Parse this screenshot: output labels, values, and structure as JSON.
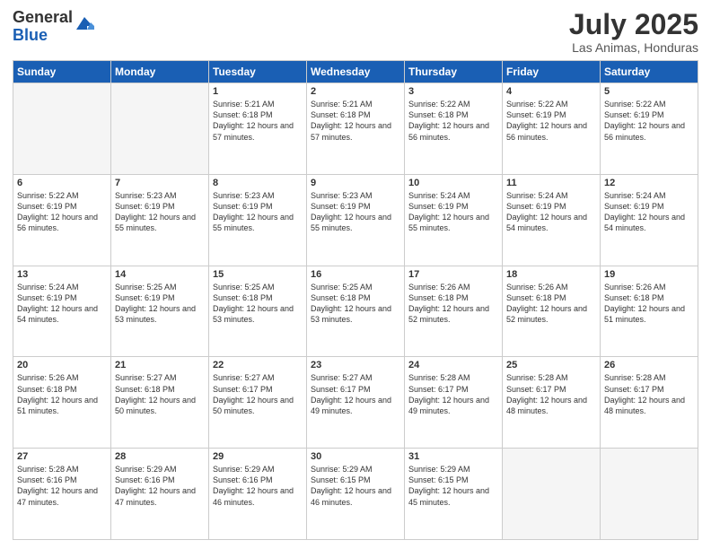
{
  "logo": {
    "general": "General",
    "blue": "Blue"
  },
  "header": {
    "month_year": "July 2025",
    "location": "Las Animas, Honduras"
  },
  "weekdays": [
    "Sunday",
    "Monday",
    "Tuesday",
    "Wednesday",
    "Thursday",
    "Friday",
    "Saturday"
  ],
  "weeks": [
    [
      {
        "day": "",
        "empty": true
      },
      {
        "day": "",
        "empty": true
      },
      {
        "day": "1",
        "sunrise": "5:21 AM",
        "sunset": "6:18 PM",
        "daylight": "12 hours and 57 minutes."
      },
      {
        "day": "2",
        "sunrise": "5:21 AM",
        "sunset": "6:18 PM",
        "daylight": "12 hours and 57 minutes."
      },
      {
        "day": "3",
        "sunrise": "5:22 AM",
        "sunset": "6:18 PM",
        "daylight": "12 hours and 56 minutes."
      },
      {
        "day": "4",
        "sunrise": "5:22 AM",
        "sunset": "6:19 PM",
        "daylight": "12 hours and 56 minutes."
      },
      {
        "day": "5",
        "sunrise": "5:22 AM",
        "sunset": "6:19 PM",
        "daylight": "12 hours and 56 minutes."
      }
    ],
    [
      {
        "day": "6",
        "sunrise": "5:22 AM",
        "sunset": "6:19 PM",
        "daylight": "12 hours and 56 minutes."
      },
      {
        "day": "7",
        "sunrise": "5:23 AM",
        "sunset": "6:19 PM",
        "daylight": "12 hours and 55 minutes."
      },
      {
        "day": "8",
        "sunrise": "5:23 AM",
        "sunset": "6:19 PM",
        "daylight": "12 hours and 55 minutes."
      },
      {
        "day": "9",
        "sunrise": "5:23 AM",
        "sunset": "6:19 PM",
        "daylight": "12 hours and 55 minutes."
      },
      {
        "day": "10",
        "sunrise": "5:24 AM",
        "sunset": "6:19 PM",
        "daylight": "12 hours and 55 minutes."
      },
      {
        "day": "11",
        "sunrise": "5:24 AM",
        "sunset": "6:19 PM",
        "daylight": "12 hours and 54 minutes."
      },
      {
        "day": "12",
        "sunrise": "5:24 AM",
        "sunset": "6:19 PM",
        "daylight": "12 hours and 54 minutes."
      }
    ],
    [
      {
        "day": "13",
        "sunrise": "5:24 AM",
        "sunset": "6:19 PM",
        "daylight": "12 hours and 54 minutes."
      },
      {
        "day": "14",
        "sunrise": "5:25 AM",
        "sunset": "6:19 PM",
        "daylight": "12 hours and 53 minutes."
      },
      {
        "day": "15",
        "sunrise": "5:25 AM",
        "sunset": "6:18 PM",
        "daylight": "12 hours and 53 minutes."
      },
      {
        "day": "16",
        "sunrise": "5:25 AM",
        "sunset": "6:18 PM",
        "daylight": "12 hours and 53 minutes."
      },
      {
        "day": "17",
        "sunrise": "5:26 AM",
        "sunset": "6:18 PM",
        "daylight": "12 hours and 52 minutes."
      },
      {
        "day": "18",
        "sunrise": "5:26 AM",
        "sunset": "6:18 PM",
        "daylight": "12 hours and 52 minutes."
      },
      {
        "day": "19",
        "sunrise": "5:26 AM",
        "sunset": "6:18 PM",
        "daylight": "12 hours and 51 minutes."
      }
    ],
    [
      {
        "day": "20",
        "sunrise": "5:26 AM",
        "sunset": "6:18 PM",
        "daylight": "12 hours and 51 minutes."
      },
      {
        "day": "21",
        "sunrise": "5:27 AM",
        "sunset": "6:18 PM",
        "daylight": "12 hours and 50 minutes."
      },
      {
        "day": "22",
        "sunrise": "5:27 AM",
        "sunset": "6:17 PM",
        "daylight": "12 hours and 50 minutes."
      },
      {
        "day": "23",
        "sunrise": "5:27 AM",
        "sunset": "6:17 PM",
        "daylight": "12 hours and 49 minutes."
      },
      {
        "day": "24",
        "sunrise": "5:28 AM",
        "sunset": "6:17 PM",
        "daylight": "12 hours and 49 minutes."
      },
      {
        "day": "25",
        "sunrise": "5:28 AM",
        "sunset": "6:17 PM",
        "daylight": "12 hours and 48 minutes."
      },
      {
        "day": "26",
        "sunrise": "5:28 AM",
        "sunset": "6:17 PM",
        "daylight": "12 hours and 48 minutes."
      }
    ],
    [
      {
        "day": "27",
        "sunrise": "5:28 AM",
        "sunset": "6:16 PM",
        "daylight": "12 hours and 47 minutes."
      },
      {
        "day": "28",
        "sunrise": "5:29 AM",
        "sunset": "6:16 PM",
        "daylight": "12 hours and 47 minutes."
      },
      {
        "day": "29",
        "sunrise": "5:29 AM",
        "sunset": "6:16 PM",
        "daylight": "12 hours and 46 minutes."
      },
      {
        "day": "30",
        "sunrise": "5:29 AM",
        "sunset": "6:15 PM",
        "daylight": "12 hours and 46 minutes."
      },
      {
        "day": "31",
        "sunrise": "5:29 AM",
        "sunset": "6:15 PM",
        "daylight": "12 hours and 45 minutes."
      },
      {
        "day": "",
        "empty": true
      },
      {
        "day": "",
        "empty": true
      }
    ]
  ]
}
